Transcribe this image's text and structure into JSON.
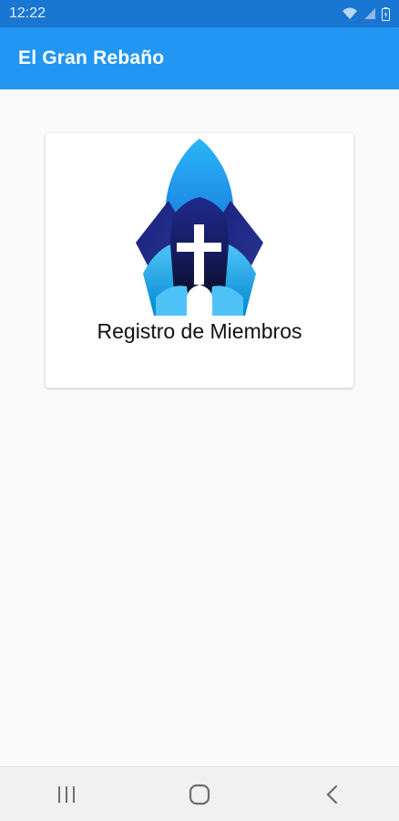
{
  "status_bar": {
    "time": "12:22",
    "icons": [
      "wifi-icon",
      "signal-icon",
      "battery-icon"
    ]
  },
  "app_bar": {
    "title": "El Gran Rebaño",
    "color": "#2196f3"
  },
  "card": {
    "logo": "church-cross-logo",
    "label": "Registro de Miembros"
  },
  "nav_bar": {
    "buttons": [
      "recent-apps-icon",
      "home-icon",
      "back-icon"
    ]
  },
  "colors": {
    "status_bar": "#1976d2",
    "background": "#fafafa",
    "logo_dark": "#1a1f6e",
    "logo_light": "#29b6f6"
  }
}
